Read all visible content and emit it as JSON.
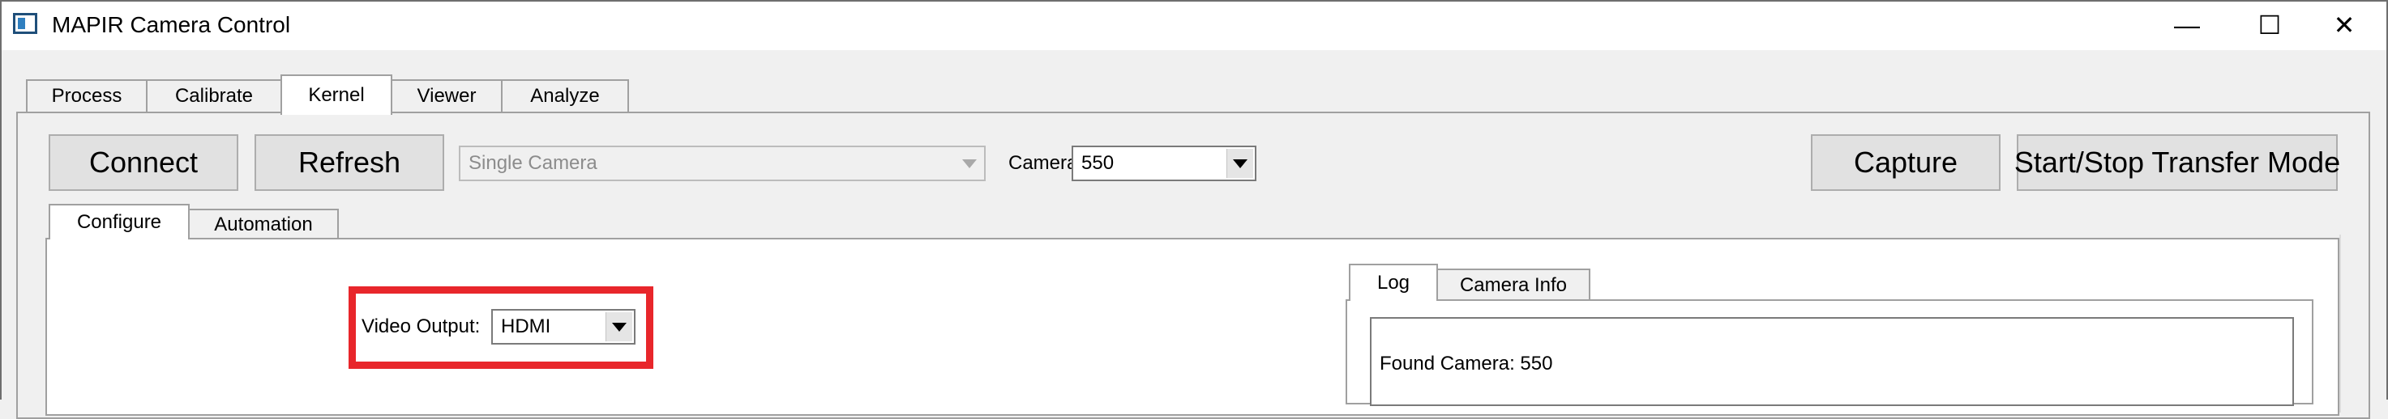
{
  "window": {
    "title": "MAPIR Camera Control",
    "minimize_glyph": "—",
    "maximize_glyph": "☐",
    "close_glyph": "✕"
  },
  "main_tabs": [
    "Process",
    "Calibrate",
    "Kernel",
    "Viewer",
    "Analyze"
  ],
  "main_tabs_active": "Kernel",
  "toolbar": {
    "connect_label": "Connect",
    "refresh_label": "Refresh",
    "mode_value": "Single Camera",
    "camera_label": "Camera:",
    "camera_value": "550",
    "capture_label": "Capture",
    "transfer_label": "Start/Stop Transfer Mode"
  },
  "sub_tabs": [
    "Configure",
    "Automation"
  ],
  "sub_tabs_active": "Configure",
  "configure": {
    "video_output_label": "Video Output:",
    "video_output_value": "HDMI"
  },
  "log_tabs": [
    "Log",
    "Camera Info"
  ],
  "log_tabs_active": "Log",
  "log": {
    "line1": "Found Camera: 550"
  },
  "colors": {
    "highlight": "#e8262b",
    "window_bg": "#f0f0f0",
    "panel_bg": "#ffffff"
  }
}
